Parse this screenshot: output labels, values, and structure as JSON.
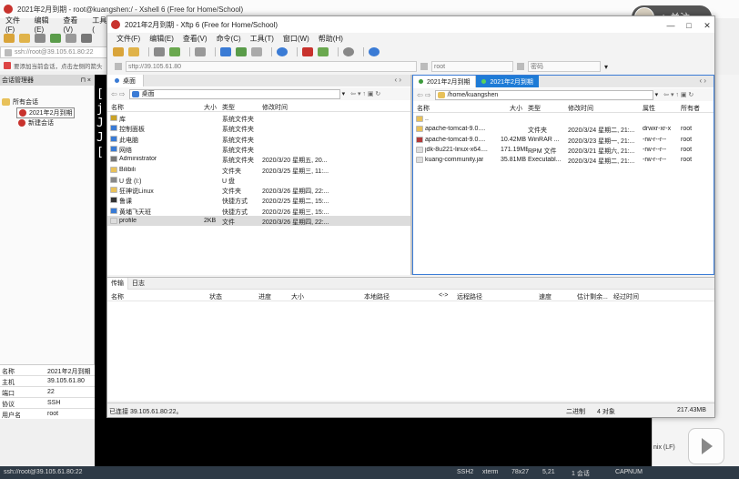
{
  "xshell": {
    "title": "2021年2月到期 - root@kuangshen:/ - Xshell 6 (Free for Home/School)",
    "menu": [
      "文件(F)",
      "编辑(E)",
      "查看(V)",
      "工具("
    ],
    "address": "ssh://root@39.105.61.80:22",
    "hint": "要添加当前会话，点击左侧的箭头",
    "session_manager_label": "会话管理器",
    "tree": {
      "root": "所有会话",
      "item1": "2021年2月到期",
      "item2": "新建会话"
    },
    "props": [
      {
        "k": "名称",
        "v": "2021年2月到期"
      },
      {
        "k": "主机",
        "v": "39.105.61.80"
      },
      {
        "k": "端口",
        "v": "22"
      },
      {
        "k": "协议",
        "v": "SSH"
      },
      {
        "k": "用户名",
        "v": "root"
      }
    ],
    "terminal_chars": [
      "[",
      "j",
      "J",
      "J",
      "["
    ],
    "right_text": "nix (LF)",
    "status": {
      "conn": "ssh://root@39.105.61.80:22",
      "proto": "SSH2",
      "term": "xterm",
      "size": "78x27",
      "pos": "5,21",
      "sessions": "1 会话",
      "cap": "CAP",
      "num": "NUM"
    }
  },
  "follow": {
    "label": "关注"
  },
  "xftp": {
    "title": "2021年2月到期 - Xftp 6 (Free for Home/School)",
    "menu": [
      "文件(F)",
      "编辑(E)",
      "查看(V)",
      "命令(C)",
      "工具(T)",
      "窗口(W)",
      "帮助(H)"
    ],
    "host_placeholder": "sftp://39.105.61.80",
    "user_placeholder": "root",
    "pass_placeholder": "密码",
    "left": {
      "tab": "桌面",
      "path": "桌面",
      "headers": [
        "名称",
        "大小",
        "类型",
        "修改时间"
      ],
      "rows": [
        {
          "name": "库",
          "size": "",
          "type": "系统文件夹",
          "date": "",
          "color": "#c9a227"
        },
        {
          "name": "控制面板",
          "size": "",
          "type": "系统文件夹",
          "date": "",
          "color": "#3a7bd5"
        },
        {
          "name": "此电脑",
          "size": "",
          "type": "系统文件夹",
          "date": "",
          "color": "#3a7bd5"
        },
        {
          "name": "网络",
          "size": "",
          "type": "系统文件夹",
          "date": "",
          "color": "#3a7bd5"
        },
        {
          "name": "Administrator",
          "size": "",
          "type": "系统文件夹",
          "date": "2020/3/20 星期五, 20...",
          "color": "#777777"
        },
        {
          "name": "Bilibili",
          "size": "",
          "type": "文件夹",
          "date": "2020/3/25 星期三, 11:...",
          "color": "#e8c15a"
        },
        {
          "name": "U 盘 (I:)",
          "size": "",
          "type": "U 盘",
          "date": "",
          "color": "#888888"
        },
        {
          "name": "狂神说Linux",
          "size": "",
          "type": "文件夹",
          "date": "2020/3/26 星期四, 22:...",
          "color": "#e8c15a"
        },
        {
          "name": "鲁课",
          "size": "",
          "type": "快捷方式",
          "date": "2020/2/25 星期二, 15:...",
          "color": "#333333"
        },
        {
          "name": "黄埔飞天班",
          "size": "",
          "type": "快捷方式",
          "date": "2020/2/26 星期三, 15:...",
          "color": "#3a7bd5"
        },
        {
          "name": "profile",
          "size": "2KB",
          "type": "文件",
          "date": "2020/3/26 星期四, 22:...",
          "color": "#dddddd"
        }
      ]
    },
    "right": {
      "tab1": "2021年2月到期",
      "tab2": "2021年2月到期",
      "path": "/home/kuangshen",
      "headers": [
        "名称",
        "大小",
        "类型",
        "修改时间",
        "属性",
        "所有者"
      ],
      "rows": [
        {
          "name": "..",
          "size": "",
          "type": "",
          "date": "",
          "attr": "",
          "owner": "",
          "color": "#e8c15a"
        },
        {
          "name": "apache-tomcat-9.0....",
          "size": "",
          "type": "文件夹",
          "date": "2020/3/24 星期二, 21:...",
          "attr": "drwxr-xr-x",
          "owner": "root",
          "color": "#e8c15a"
        },
        {
          "name": "apache-tomcat-9.0....",
          "size": "10.42MB",
          "type": "WinRAR ...",
          "date": "2020/3/23 星期一, 21:...",
          "attr": "-rw-r--r--",
          "owner": "root",
          "color": "#b23a3a"
        },
        {
          "name": "jdk-8u221-linux-x64....",
          "size": "171.19MB",
          "type": "RPM 文件",
          "date": "2020/3/21 星期六, 21:...",
          "attr": "-rw-r--r--",
          "owner": "root",
          "color": "#dddddd"
        },
        {
          "name": "kuang-community.jar",
          "size": "35.81MB",
          "type": "Executabl...",
          "date": "2020/3/24 星期二, 21:...",
          "attr": "-rw-r--r--",
          "owner": "root",
          "color": "#dddddd"
        }
      ]
    },
    "transfer": {
      "tab1": "传输",
      "tab2": "日志",
      "headers": [
        "名称",
        "状态",
        "进度",
        "大小",
        "本地路径",
        "<->",
        "远程路径",
        "速度",
        "估计剩余...",
        "经过时间"
      ]
    },
    "status": {
      "left": "已连接 39.105.61.80:22。",
      "mode": "二进制",
      "count": "4 对象",
      "total": "217.43MB"
    }
  }
}
